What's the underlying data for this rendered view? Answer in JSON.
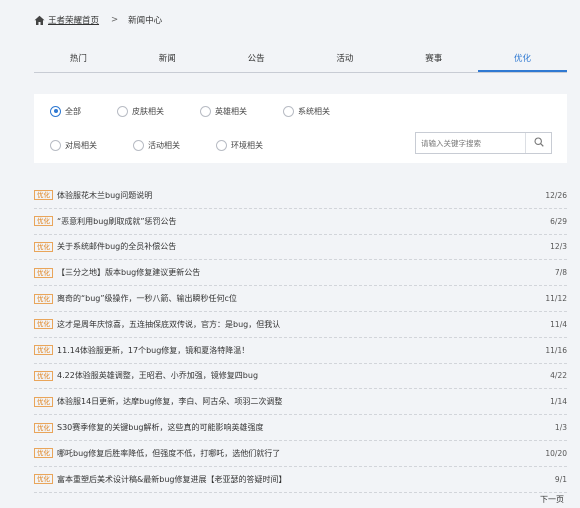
{
  "breadcrumb": {
    "home_label": "王者荣耀首页",
    "separator": ">",
    "current": "新闻中心"
  },
  "tabs": [
    {
      "label": "热门",
      "active": false
    },
    {
      "label": "新闻",
      "active": false
    },
    {
      "label": "公告",
      "active": false
    },
    {
      "label": "活动",
      "active": false
    },
    {
      "label": "赛事",
      "active": false
    },
    {
      "label": "优化",
      "active": true
    }
  ],
  "filters": {
    "row1": [
      {
        "label": "全部",
        "checked": true
      },
      {
        "label": "皮肤相关",
        "checked": false
      },
      {
        "label": "英雄相关",
        "checked": false
      },
      {
        "label": "系统相关",
        "checked": false
      }
    ],
    "row2": [
      {
        "label": "对局相关",
        "checked": false
      },
      {
        "label": "活动相关",
        "checked": false
      },
      {
        "label": "环境相关",
        "checked": false
      }
    ],
    "search_placeholder": "请输入关键字搜索"
  },
  "news": [
    {
      "badge": "优化",
      "title": "体验服花木兰bug问题说明",
      "date": "12/26"
    },
    {
      "badge": "优化",
      "title": "“恶意利用bug刷取成就”惩罚公告",
      "date": "6/29"
    },
    {
      "badge": "优化",
      "title": "关于系统邮件bug的全员补偿公告",
      "date": "12/3"
    },
    {
      "badge": "优化",
      "title": "【三分之地】版本bug修复建议更新公告",
      "date": "7/8"
    },
    {
      "badge": "优化",
      "title": "离奇的“bug”级操作，一秒八箭、输出瞬秒任何c位",
      "date": "11/12"
    },
    {
      "badge": "优化",
      "title": "这才是周年庆惊喜，五连抽保底双传说，官方：是bug，但我认",
      "date": "11/4"
    },
    {
      "badge": "优化",
      "title": "11.14体验服更新，17个bug修复，镜和夏洛特降温！",
      "date": "11/16"
    },
    {
      "badge": "优化",
      "title": "4.22体验服英雄调整，王昭君、小乔加强，镜修复四bug",
      "date": "4/22"
    },
    {
      "badge": "优化",
      "title": "体验服14日更新，达摩bug修复，李白、阿古朵、项羽二次调整",
      "date": "1/14"
    },
    {
      "badge": "优化",
      "title": "S30赛季修复的关键bug解析，这些真的可能影响英雄强度",
      "date": "1/3"
    },
    {
      "badge": "优化",
      "title": "哪吒bug修复后胜率降低，但强度不低，打哪吒，选他们就行了",
      "date": "10/20"
    },
    {
      "badge": "优化",
      "title": "富本重塑后美术设计稿&最新bug修复进展【老亚瑟的答疑时间】",
      "date": "9/1"
    }
  ],
  "pager": {
    "next_label": "下一页"
  },
  "colors": {
    "accent": "#2f79d2",
    "badge": "#e0821d",
    "background": "#f2f4f7"
  },
  "icons": {
    "home": "home-icon",
    "search": "search-icon"
  }
}
